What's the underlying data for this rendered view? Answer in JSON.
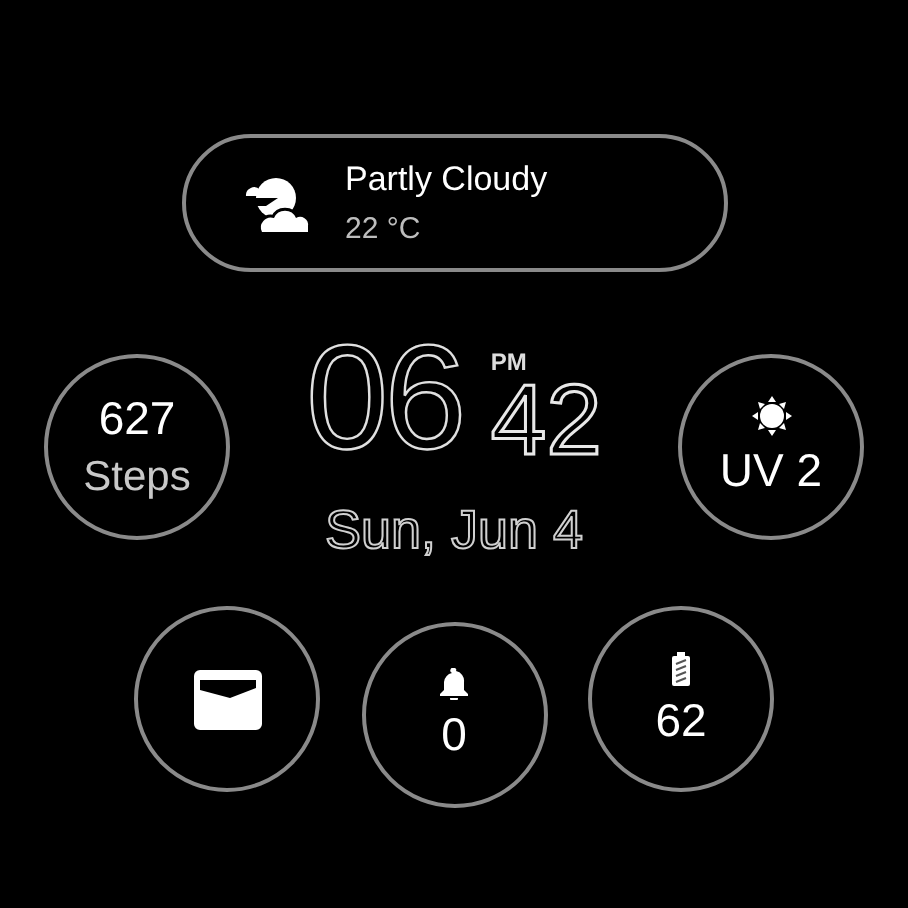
{
  "weather": {
    "condition": "Partly Cloudy",
    "temperature": "22 °C"
  },
  "time": {
    "hours": "06",
    "period": "PM",
    "minutes": "42"
  },
  "date": "Sun, Jun 4",
  "steps": {
    "value": "627",
    "label": "Steps"
  },
  "uv": {
    "label": "UV 2"
  },
  "complications": [
    {
      "kind": "wallet"
    },
    {
      "kind": "notifications",
      "value": "0"
    },
    {
      "kind": "battery",
      "value": "62"
    }
  ]
}
